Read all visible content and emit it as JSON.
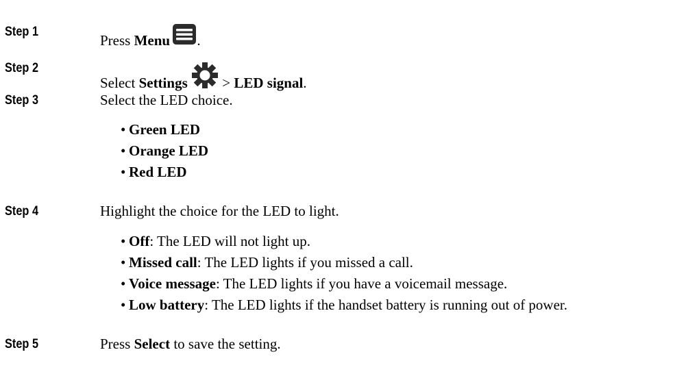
{
  "steps": [
    {
      "label": "Step 1",
      "pre": "Press ",
      "bold": "Menu",
      "post": "."
    },
    {
      "label": "Step 2",
      "pre": "Select ",
      "bold": "Settings",
      "mid": " > ",
      "bold2": "LED signal",
      "post": "."
    },
    {
      "label": "Step 3",
      "text": "Select the LED choice."
    },
    {
      "label": "Step 4",
      "text": "Highlight the choice for the LED to light."
    },
    {
      "label": "Step 5",
      "pre": "Press ",
      "bold": "Select",
      "post": " to save the setting."
    }
  ],
  "led_choices": [
    "Green LED",
    "Orange LED",
    "Red LED"
  ],
  "light_options": [
    {
      "term": "Off",
      "desc": ": The LED will not light up."
    },
    {
      "term": "Missed call",
      "desc": ": The LED lights if you missed a call."
    },
    {
      "term": "Voice message",
      "desc": ": The LED lights if you have a voicemail message."
    },
    {
      "term": "Low battery",
      "desc": ": The LED lights if the handset battery is running out of power."
    }
  ],
  "icons": {
    "menu": "menu-icon",
    "settings": "settings-gear-icon"
  }
}
